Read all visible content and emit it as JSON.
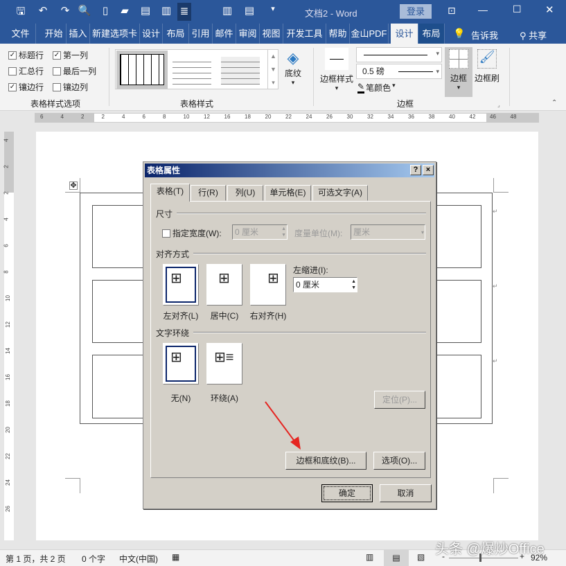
{
  "titlebar": {
    "title": "文档2 - Word",
    "login": "登录"
  },
  "tabs": [
    "文件",
    "开始",
    "插入",
    "新建选项卡",
    "设计",
    "布局",
    "引用",
    "邮件",
    "审阅",
    "视图",
    "开发工具",
    "帮助",
    "金山PDF",
    "设计",
    "布局"
  ],
  "tell_me": "告诉我",
  "share": "共享",
  "ribbon": {
    "options": [
      {
        "label": "标题行",
        "checked": true
      },
      {
        "label": "第一列",
        "checked": true
      },
      {
        "label": "汇总行",
        "checked": false
      },
      {
        "label": "最后一列",
        "checked": false
      },
      {
        "label": "镶边行",
        "checked": true
      },
      {
        "label": "镶边列",
        "checked": false
      }
    ],
    "group1": "表格样式选项",
    "group2": "表格样式",
    "shading": "底纹",
    "border_styles": "边框样式",
    "weight": "0.5 磅",
    "pen_color": "笔颜色",
    "borders": "边框",
    "border_painter": "边框刷",
    "group3": "边框"
  },
  "ruler": {
    "top": [
      "6",
      "4",
      "2",
      "2",
      "4",
      "6",
      "8",
      "10",
      "12",
      "16",
      "18",
      "20",
      "22",
      "24",
      "26",
      "30",
      "32",
      "34",
      "36",
      "38",
      "40",
      "42",
      "46",
      "48"
    ],
    "left": [
      "4",
      "2",
      "2",
      "4",
      "6",
      "8",
      "10",
      "12",
      "14",
      "16",
      "18",
      "20",
      "22",
      "24",
      "26"
    ]
  },
  "dialog": {
    "title": "表格属性",
    "help": "?",
    "close": "×",
    "tabs": [
      "表格(T)",
      "行(R)",
      "列(U)",
      "单元格(E)",
      "可选文字(A)"
    ],
    "size_section": "尺寸",
    "preferred_width": "指定宽度(W):",
    "width_value": "0 厘米",
    "measure_in": "度量单位(M):",
    "measure_value": "厘米",
    "align_section": "对齐方式",
    "align": [
      "左对齐(L)",
      "居中(C)",
      "右对齐(H)"
    ],
    "indent_label": "左缩进(I):",
    "indent_value": "0 厘米",
    "wrap_section": "文字环绕",
    "wrap": [
      "无(N)",
      "环绕(A)"
    ],
    "positioning": "定位(P)...",
    "borders_shading": "边框和底纹(B)...",
    "options": "选项(O)...",
    "ok": "确定",
    "cancel": "取消"
  },
  "status": {
    "page": "第 1 页，共 2 页",
    "words": "0 个字",
    "lang": "中文(中国)",
    "zoom": "92%"
  },
  "watermark": "头条 @爆炒Office",
  "colors": {
    "accent": "#2b579a",
    "dialog": "#d4d0c8",
    "arrow": "#e52521"
  }
}
